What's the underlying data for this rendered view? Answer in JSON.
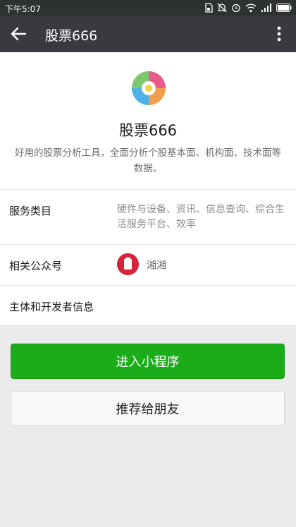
{
  "status_bar": {
    "time": "下午5:07",
    "icons": [
      "sim-card-icon",
      "mute-icon",
      "alarm-icon",
      "wifi-icon",
      "signal-icon",
      "battery-icon"
    ]
  },
  "app_bar": {
    "title": "股票666",
    "back_icon": "back-arrow-icon",
    "more_icon": "more-vertical-icon"
  },
  "profile": {
    "name": "股票666",
    "description": "好用的股票分析工具，全面分析个股基本面、机构面、技术面等数据。"
  },
  "info_rows": {
    "category_label": "服务类目",
    "category_value": "硬件与设备、资讯、信息查询、综合生活服务平台、效率",
    "account_label": "相关公众号",
    "account_name": "湘湘",
    "developer_label": "主体和开发者信息"
  },
  "actions": {
    "enter_label": "进入小程序",
    "share_label": "推荐给朋友"
  },
  "colors": {
    "status_bar": "#2e3132",
    "app_bar": "#393a3f",
    "primary_green": "#1aad19",
    "avatar_red": "#d7233a"
  }
}
